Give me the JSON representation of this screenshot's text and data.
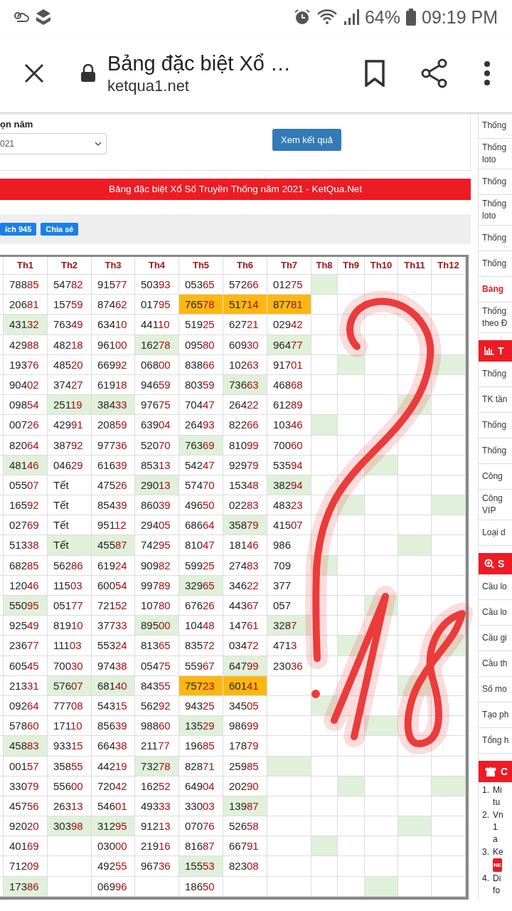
{
  "status_bar": {
    "battery": "64%",
    "time": "09:19 PM"
  },
  "browser": {
    "title": "Bảng đặc biệt Xổ …",
    "url": "ketqua1.net"
  },
  "form": {
    "label": "ọn năm",
    "select_value": "021",
    "submit": "Xem kết quả"
  },
  "banner": "Bảng đặc biệt Xổ Số Truyền Thống năm 2021 - KetQua.Net",
  "actions": [
    "ích 945",
    "Chia sẻ"
  ],
  "table": {
    "columns": [
      "Th1",
      "Th2",
      "Th3",
      "Th4",
      "Th5",
      "Th6",
      "Th7",
      "Th8",
      "Th9",
      "Th10",
      "Th11",
      "Th12"
    ],
    "rows": [
      {
        "cells": [
          {
            "text": "78885"
          },
          {
            "text": "54782"
          },
          {
            "text": "91577"
          },
          {
            "text": "50393"
          },
          {
            "text": "05365"
          },
          {
            "text": "57266"
          },
          {
            "text": "01275"
          },
          {
            "color": "#e0f0da"
          },
          {},
          {},
          {},
          {}
        ]
      },
      {
        "cells": [
          {
            "text": "20681"
          },
          {
            "text": "15759"
          },
          {
            "text": "87462"
          },
          {
            "text": "01795"
          },
          {
            "text": "76578",
            "color": "#fdb713"
          },
          {
            "text": "51714",
            "color": "#fdb713"
          },
          {
            "text": "87781",
            "color": "#fdb713"
          },
          {},
          {},
          {},
          {},
          {}
        ]
      },
      {
        "cells": [
          {
            "text": "43132",
            "color": "#e0f0da"
          },
          {
            "text": "76349"
          },
          {
            "text": "63410"
          },
          {
            "text": "44110"
          },
          {
            "text": "51925"
          },
          {
            "text": "62721"
          },
          {
            "text": "02942"
          },
          {},
          {},
          {},
          {},
          {}
        ]
      },
      {
        "cells": [
          {
            "text": "42988"
          },
          {
            "text": "48218"
          },
          {
            "text": "96100"
          },
          {
            "text": "16278",
            "color": "#e0f0da"
          },
          {
            "text": "09580"
          },
          {
            "text": "60930"
          },
          {
            "text": "96477",
            "color": "#e0f0da"
          },
          {},
          {},
          {},
          {},
          {}
        ]
      },
      {
        "cells": [
          {
            "text": "19376"
          },
          {
            "text": "48520"
          },
          {
            "text": "66992"
          },
          {
            "text": "06800"
          },
          {
            "text": "83866"
          },
          {
            "text": "10263"
          },
          {
            "text": "91701"
          },
          {},
          {
            "color": "#e0f0da"
          },
          {},
          {},
          {
            "color": "#e0f0da"
          }
        ]
      },
      {
        "cells": [
          {
            "text": "90402"
          },
          {
            "text": "37427"
          },
          {
            "text": "61918"
          },
          {
            "text": "94659"
          },
          {
            "text": "80359"
          },
          {
            "text": "73663",
            "color": "#e0f0da"
          },
          {
            "text": "46868"
          },
          {},
          {},
          {},
          {},
          {}
        ]
      },
      {
        "cells": [
          {
            "text": "09854"
          },
          {
            "text": "25119",
            "color": "#e0f0da"
          },
          {
            "text": "38433",
            "color": "#e0f0da"
          },
          {
            "text": "97675"
          },
          {
            "text": "70447"
          },
          {
            "text": "26422"
          },
          {
            "text": "61289"
          },
          {},
          {},
          {},
          {
            "color": "#e0f0da"
          },
          {}
        ]
      },
      {
        "cells": [
          {
            "text": "00726"
          },
          {
            "text": "42991"
          },
          {
            "text": "20859"
          },
          {
            "text": "63904"
          },
          {
            "text": "26493"
          },
          {
            "text": "82266"
          },
          {
            "text": "10346"
          },
          {
            "color": "#e0f0da"
          },
          {},
          {},
          {},
          {}
        ]
      },
      {
        "cells": [
          {
            "text": "82064"
          },
          {
            "text": "38792"
          },
          {
            "text": "97736"
          },
          {
            "text": "52070"
          },
          {
            "text": "76369",
            "color": "#e0f0da"
          },
          {
            "text": "81099"
          },
          {
            "text": "70060"
          },
          {},
          {},
          {},
          {},
          {}
        ]
      },
      {
        "cells": [
          {
            "text": "48146",
            "color": "#e0f0da"
          },
          {
            "text": "04629"
          },
          {
            "text": "61639"
          },
          {
            "text": "85313"
          },
          {
            "text": "54247"
          },
          {
            "text": "92979"
          },
          {
            "text": "53594"
          },
          {},
          {},
          {
            "color": "#e0f0da"
          },
          {},
          {}
        ]
      },
      {
        "cells": [
          {
            "text": "05507"
          },
          {
            "text": "Tết"
          },
          {
            "text": "47526"
          },
          {
            "text": "29013",
            "color": "#e0f0da"
          },
          {
            "text": "57470"
          },
          {
            "text": "15348"
          },
          {
            "text": "38294",
            "color": "#e0f0da"
          },
          {},
          {},
          {},
          {},
          {}
        ]
      },
      {
        "cells": [
          {
            "text": "16592"
          },
          {
            "text": "Tết"
          },
          {
            "text": "85439"
          },
          {
            "text": "86039"
          },
          {
            "text": "49650"
          },
          {
            "text": "02283"
          },
          {
            "text": "48323"
          },
          {},
          {
            "color": "#e0f0da"
          },
          {},
          {},
          {
            "color": "#e0f0da"
          }
        ]
      },
      {
        "cells": [
          {
            "text": "02769"
          },
          {
            "text": "Tết"
          },
          {
            "text": "95112"
          },
          {
            "text": "29405"
          },
          {
            "text": "68664"
          },
          {
            "text": "35879",
            "color": "#e0f0da"
          },
          {
            "text": "41507"
          },
          {},
          {},
          {},
          {},
          {}
        ]
      },
      {
        "cells": [
          {
            "text": "51338"
          },
          {
            "text": "Tết",
            "color": "#e0f0da"
          },
          {
            "text": "45587",
            "color": "#e0f0da"
          },
          {
            "text": "74295"
          },
          {
            "text": "81047"
          },
          {
            "text": "18146"
          },
          {
            "text": "986"
          },
          {},
          {},
          {},
          {
            "color": "#e0f0da"
          },
          {}
        ]
      },
      {
        "cells": [
          {
            "text": "68285"
          },
          {
            "text": "56286"
          },
          {
            "text": "61924"
          },
          {
            "text": "90982"
          },
          {
            "text": "59925"
          },
          {
            "text": "27483"
          },
          {
            "text": "709"
          },
          {
            "color": "#e0f0da"
          },
          {},
          {},
          {},
          {}
        ]
      },
      {
        "cells": [
          {
            "text": "12046"
          },
          {
            "text": "11503"
          },
          {
            "text": "60054"
          },
          {
            "text": "99789"
          },
          {
            "text": "32965",
            "color": "#e0f0da"
          },
          {
            "text": "34622"
          },
          {
            "text": "377"
          },
          {},
          {},
          {},
          {},
          {}
        ]
      },
      {
        "cells": [
          {
            "text": "55095",
            "color": "#e0f0da"
          },
          {
            "text": "05177"
          },
          {
            "text": "72152"
          },
          {
            "text": "10780"
          },
          {
            "text": "67626"
          },
          {
            "text": "44367"
          },
          {
            "text": "057"
          },
          {},
          {},
          {
            "color": "#e0f0da"
          },
          {},
          {}
        ]
      },
      {
        "cells": [
          {
            "text": "92549"
          },
          {
            "text": "81910"
          },
          {
            "text": "37733"
          },
          {
            "text": "89500",
            "color": "#e0f0da"
          },
          {
            "text": "10448"
          },
          {
            "text": "14761"
          },
          {
            "text": "3287",
            "color": "#e0f0da"
          },
          {},
          {},
          {},
          {},
          {}
        ]
      },
      {
        "cells": [
          {
            "text": "23677"
          },
          {
            "text": "11103"
          },
          {
            "text": "55324"
          },
          {
            "text": "81365"
          },
          {
            "text": "83572"
          },
          {
            "text": "03472"
          },
          {
            "text": "4713"
          },
          {},
          {
            "color": "#e0f0da"
          },
          {},
          {},
          {
            "color": "#e0f0da"
          }
        ]
      },
      {
        "cells": [
          {
            "text": "60545"
          },
          {
            "text": "70030"
          },
          {
            "text": "97438"
          },
          {
            "text": "05475"
          },
          {
            "text": "55967"
          },
          {
            "text": "64799",
            "color": "#e0f0da"
          },
          {
            "text": "23036"
          },
          {},
          {},
          {},
          {},
          {}
        ]
      },
      {
        "cells": [
          {
            "text": "21331"
          },
          {
            "text": "57607",
            "color": "#e0f0da"
          },
          {
            "text": "68140",
            "color": "#e0f0da"
          },
          {
            "text": "84355"
          },
          {
            "text": "75723",
            "color": "#fdb713"
          },
          {
            "text": "60141",
            "color": "#fdb713"
          },
          {},
          {},
          {},
          {},
          {
            "color": "#e0f0da"
          },
          {}
        ]
      },
      {
        "cells": [
          {
            "text": "09264"
          },
          {
            "text": "77708"
          },
          {
            "text": "54315"
          },
          {
            "text": "56292"
          },
          {
            "text": "94325"
          },
          {
            "text": "34505"
          },
          {},
          {
            "color": "#e0f0da"
          },
          {},
          {},
          {},
          {}
        ]
      },
      {
        "cells": [
          {
            "text": "57860"
          },
          {
            "text": "17110"
          },
          {
            "text": "85639"
          },
          {
            "text": "98860"
          },
          {
            "text": "13529",
            "color": "#e0f0da"
          },
          {
            "text": "98699"
          },
          {},
          {},
          {},
          {
            "color": "#e0f0da"
          },
          {},
          {}
        ]
      },
      {
        "cells": [
          {
            "text": "45883",
            "color": "#e0f0da"
          },
          {
            "text": "93315"
          },
          {
            "text": "66438"
          },
          {
            "text": "21177"
          },
          {
            "text": "19685"
          },
          {
            "text": "17879"
          },
          {},
          {},
          {},
          {},
          {},
          {}
        ]
      },
      {
        "cells": [
          {
            "text": "00157"
          },
          {
            "text": "35855"
          },
          {
            "text": "44219"
          },
          {
            "text": "73278",
            "color": "#e0f0da"
          },
          {
            "text": "82871"
          },
          {
            "text": "25985"
          },
          {
            "color": "#e0f0da"
          },
          {},
          {},
          {},
          {},
          {}
        ]
      },
      {
        "cells": [
          {
            "text": "33079"
          },
          {
            "text": "55600"
          },
          {
            "text": "72042"
          },
          {
            "text": "16252"
          },
          {
            "text": "64904"
          },
          {
            "text": "20290"
          },
          {},
          {},
          {
            "color": "#e0f0da"
          },
          {},
          {},
          {
            "color": "#e0f0da"
          }
        ]
      },
      {
        "cells": [
          {
            "text": "45756"
          },
          {
            "text": "26313"
          },
          {
            "text": "54601"
          },
          {
            "text": "49333"
          },
          {
            "text": "33003"
          },
          {
            "text": "13987",
            "color": "#e0f0da"
          },
          {},
          {},
          {},
          {},
          {},
          {}
        ]
      },
      {
        "cells": [
          {
            "text": "92020"
          },
          {
            "text": "30398",
            "color": "#e0f0da"
          },
          {
            "text": "31295",
            "color": "#e0f0da"
          },
          {
            "text": "91213"
          },
          {
            "text": "07076"
          },
          {
            "text": "52658"
          },
          {},
          {},
          {},
          {},
          {
            "color": "#e0f0da"
          },
          {}
        ]
      },
      {
        "cells": [
          {
            "text": "40169"
          },
          {},
          {
            "text": "03000"
          },
          {
            "text": "21916"
          },
          {
            "text": "81687"
          },
          {
            "text": "66791"
          },
          {},
          {
            "color": "#e0f0da"
          },
          {},
          {},
          {},
          {}
        ]
      },
      {
        "cells": [
          {
            "text": "71209"
          },
          {},
          {
            "text": "49255"
          },
          {
            "text": "96736"
          },
          {
            "text": "15553",
            "color": "#e0f0da"
          },
          {
            "text": "82308"
          },
          {},
          {},
          {},
          {},
          {},
          {}
        ]
      },
      {
        "cells": [
          {
            "text": "17386",
            "color": "#e0f0da"
          },
          {},
          {
            "text": "06996"
          },
          {},
          {
            "text": "18650"
          },
          {},
          {},
          {},
          {},
          {
            "color": "#e0f0da"
          },
          {},
          {}
        ]
      }
    ]
  },
  "sidebar": [
    {
      "kind": "links",
      "items": [
        {
          "text": "Thống",
          "active": false
        },
        {
          "text": "Thống loto",
          "active": false
        },
        {
          "text": "Thống",
          "active": false
        },
        {
          "text": "Thống loto",
          "active": false
        },
        {
          "text": "Thống",
          "active": false
        },
        {
          "text": "Thống",
          "active": false
        },
        {
          "text": "Bảng",
          "active": true
        },
        {
          "text": "Thống theo Đ",
          "active": false
        }
      ]
    },
    {
      "kind": "links",
      "header": "T",
      "items": [
        {
          "text": "Thống",
          "active": false
        },
        {
          "text": "TK tần",
          "active": false
        },
        {
          "text": "Thống",
          "active": false
        },
        {
          "text": "Thống",
          "active": false
        },
        {
          "text": "Công",
          "active": false
        },
        {
          "text": "Công VIP",
          "active": false
        },
        {
          "text": "Loại d",
          "active": false
        }
      ]
    },
    {
      "kind": "links",
      "header": "S",
      "items": [
        {
          "text": "Cầu lo",
          "active": false
        },
        {
          "text": "Cầu lo",
          "active": false
        },
        {
          "text": "Cầu gi",
          "active": false
        },
        {
          "text": "Cầu th",
          "active": false
        },
        {
          "text": "Số mo",
          "active": false
        },
        {
          "text": "Tạo ph",
          "active": false
        },
        {
          "text": "Tổng h",
          "active": false
        }
      ]
    },
    {
      "kind": "numbered",
      "header": "C",
      "items": [
        {
          "number": "1.",
          "text": "Mi tu"
        },
        {
          "number": "2.",
          "text": "Vn 1 a"
        },
        {
          "number": "3.",
          "text": "Ke",
          "badge": "NE"
        },
        {
          "number": "4.",
          "text": "Di fo"
        }
      ]
    }
  ]
}
